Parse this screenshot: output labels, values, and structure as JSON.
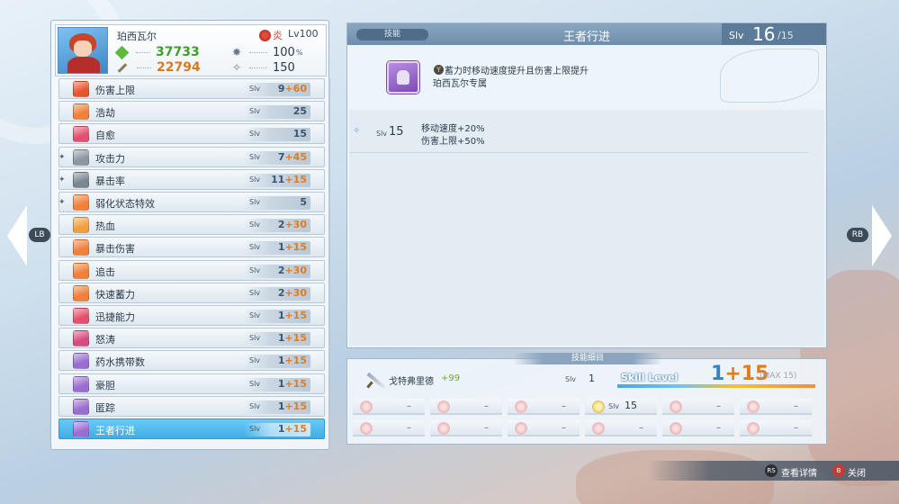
{
  "character": {
    "name": "珀西瓦尔",
    "element": "炎",
    "level": "Lv100",
    "hp": "37733",
    "attack": "22794",
    "crit_value": "100",
    "crit_unit": "%",
    "speed_value": "150"
  },
  "skills": [
    {
      "name": "伤害上限",
      "lv": "9",
      "plus": "+60",
      "color": "#e8542e",
      "marker": ""
    },
    {
      "name": "浩劫",
      "lv": "25",
      "plus": "",
      "color": "#f0803a",
      "marker": ""
    },
    {
      "name": "自愈",
      "lv": "15",
      "plus": "",
      "color": "#e2506e",
      "marker": ""
    },
    {
      "name": "攻击力",
      "lv": "7",
      "plus": "+45",
      "color": "#8c97a2",
      "marker": "✦"
    },
    {
      "name": "暴击率",
      "lv": "11",
      "plus": "+15",
      "color": "#7a8692",
      "marker": "✦"
    },
    {
      "name": "弱化状态特效",
      "lv": "5",
      "plus": "",
      "color": "#f0803a",
      "marker": "✦"
    },
    {
      "name": "热血",
      "lv": "2",
      "plus": "+30",
      "color": "#f0a040",
      "marker": ""
    },
    {
      "name": "暴击伤害",
      "lv": "1",
      "plus": "+15",
      "color": "#f0803a",
      "marker": ""
    },
    {
      "name": "追击",
      "lv": "2",
      "plus": "+30",
      "color": "#f0803a",
      "marker": ""
    },
    {
      "name": "快速蓄力",
      "lv": "2",
      "plus": "+30",
      "color": "#f0803a",
      "marker": ""
    },
    {
      "name": "迅捷能力",
      "lv": "1",
      "plus": "+15",
      "color": "#e2506e",
      "marker": ""
    },
    {
      "name": "怒涛",
      "lv": "1",
      "plus": "+15",
      "color": "#d84a82",
      "marker": ""
    },
    {
      "name": "药水携带数",
      "lv": "1",
      "plus": "+15",
      "color": "#9a6ed0",
      "marker": ""
    },
    {
      "name": "豪胆",
      "lv": "1",
      "plus": "+15",
      "color": "#9a6ed0",
      "marker": ""
    },
    {
      "name": "匿踪",
      "lv": "1",
      "plus": "+15",
      "color": "#9a6ed0",
      "marker": ""
    },
    {
      "name": "王者行进",
      "lv": "1",
      "plus": "+15",
      "color": "#9a6ed0",
      "marker": ""
    }
  ],
  "detail": {
    "tag": "技能",
    "title": "王者行进",
    "slv_label": "Slv",
    "slv_current": "16",
    "slv_max": "/15",
    "desc_line1": "蓄力时移动速度提升且伤害上限提升",
    "desc_line2": "珀西瓦尔专属",
    "y_button": "Y",
    "level_row": {
      "slv_label": "Slv",
      "slv": "15",
      "effect1": "移动速度+20%",
      "effect2": "伤害上限+50%"
    }
  },
  "source": {
    "tag": "技能细目",
    "weapon_name": "戈特弗里德",
    "weapon_plus": "+99",
    "weapon_slv_label": "Slv",
    "weapon_slv": "1",
    "skill_level_label": "Skill Level",
    "skill_level_value": "1",
    "skill_level_plus": "+15",
    "skill_level_max": "(MAX 15)",
    "gem_slots": [
      {
        "dash": "–",
        "slv": "",
        "type": "flower"
      },
      {
        "dash": "–",
        "slv": "",
        "type": "flower"
      },
      {
        "dash": "–",
        "slv": "",
        "type": "flower"
      },
      {
        "dash": "",
        "slv": "15",
        "type": "star"
      },
      {
        "dash": "–",
        "slv": "",
        "type": "flower"
      },
      {
        "dash": "–",
        "slv": "",
        "type": "flower"
      },
      {
        "dash": "–",
        "slv": "",
        "type": "flower"
      },
      {
        "dash": "–",
        "slv": "",
        "type": "flower"
      },
      {
        "dash": "–",
        "slv": "",
        "type": "flower"
      },
      {
        "dash": "–",
        "slv": "",
        "type": "flower"
      },
      {
        "dash": "–",
        "slv": "",
        "type": "flower"
      },
      {
        "dash": "–",
        "slv": "",
        "type": "flower"
      }
    ]
  },
  "nav": {
    "left": "LB",
    "right": "RB"
  },
  "footer": {
    "rs_label": "RS",
    "details": "查看详情",
    "b_label": "B",
    "close": "关闭"
  }
}
